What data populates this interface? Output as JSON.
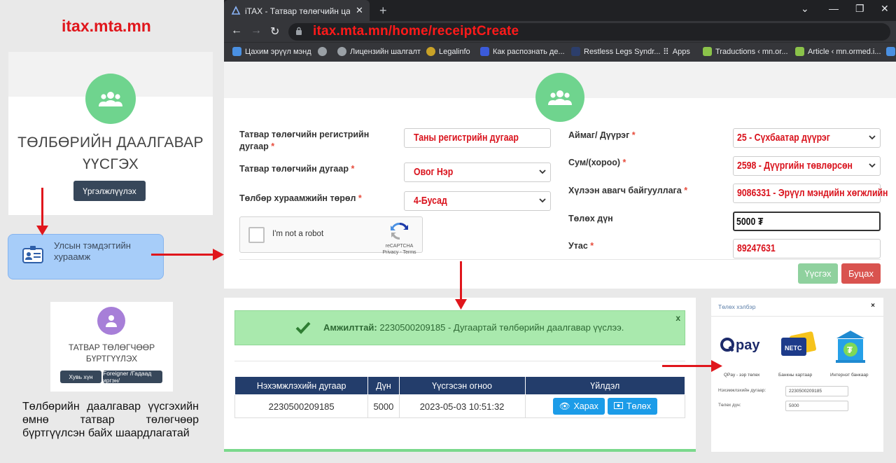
{
  "annotation": {
    "site_title": "itax.mta.mn",
    "note": "Төлбөрийн даалгавар үүсгэхийн өмнө татвар төлөгчөөр бүртгүүлсэн байх шаардлагатай"
  },
  "left_card": {
    "title": "ТӨЛБӨРИЙН ДААЛГАВАР ҮҮСГЭХ",
    "button": "Үргэлжлүүлэх",
    "icon": "users-icon"
  },
  "service_box": {
    "label": "Улсын тэмдэгтийн хураамж",
    "icon": "id-card-icon"
  },
  "register_card": {
    "title": "ТАТВАР ТӨЛӨГЧӨӨР БҮРТГҮҮЛЭХ",
    "btn_citizen": "Хувь хүн",
    "btn_foreigner": "Foreigner /Гадаад иргэн/",
    "icon": "user-icon"
  },
  "browser": {
    "tab_title": "iTAX - Татвар төлөгчийн цахим",
    "url": "itax.mta.mn/home/receiptCreate",
    "bookmarks": [
      {
        "label": "Цахим эрүүл мэнд",
        "color": "#4a90e2"
      },
      {
        "label": "",
        "color": "#9aa0a6"
      },
      {
        "label": "Лицензийн шалгалт",
        "color": "#9aa0a6"
      },
      {
        "label": "Legalinfo",
        "color": "#c9a227"
      },
      {
        "label": "Как распознать де...",
        "color": "#3b5bdb"
      },
      {
        "label": "Restless Legs Syndr...",
        "color": "#2c3e6b"
      },
      {
        "label": "Apps",
        "color": "#9aa0a6"
      },
      {
        "label": "Traductions ‹ mn.or...",
        "color": "#8bc34a"
      },
      {
        "label": "Article ‹ mn.ormed.i...",
        "color": "#8bc34a"
      }
    ]
  },
  "form": {
    "fields": {
      "reg_no": {
        "label": "Татвар төлөгчийн регистрийн дугаар",
        "value": "Таны регистрийн дугаар"
      },
      "tin": {
        "label": "Татвар төлөгчийн дугаар",
        "value": "Овог Нэр"
      },
      "fee_type": {
        "label": "Төлбөр хураамжийн төрөл",
        "value": "4-Бусад"
      },
      "aimag": {
        "label": "Аймаг/ Дүүрэг",
        "value": "25 - Сүхбаатар дүүрэг"
      },
      "sum": {
        "label": "Сум/(хороо)",
        "value": "2598 - Дүүргийн төвлөрсөн"
      },
      "org": {
        "label": "Хүлээн авагч байгууллага",
        "value": "9086331 - Эрүүл мэндийн хөгжлийн"
      },
      "amount": {
        "label": "Төлөх дүн",
        "value": "5000 ₮"
      },
      "phone": {
        "label": "Утас",
        "value": "89247631"
      }
    },
    "required_mark": "*",
    "captcha": {
      "text": "I'm not a robot",
      "brand": "reCAPTCHA",
      "links": "Privacy - Terms"
    },
    "btn_create": "Үүсгэх",
    "btn_back": "Буцах",
    "colors": {
      "create": "#8fd19e",
      "back": "#d9534f"
    }
  },
  "success": {
    "strong": "Амжилттай:",
    "message": " 2230500209185 - Дугаартай төлбөрийн даалгавар үүслээ.",
    "close": "x",
    "table": {
      "headers": [
        "Нэхэмжлэхийн дугаар",
        "Дүн",
        "Үүсгэсэн огноо",
        "Үйлдэл"
      ],
      "row": [
        "2230500209185",
        "5000",
        "2023-05-03 10:51:32"
      ],
      "btn_view": "Харах",
      "btn_pay": "Төлөх"
    }
  },
  "payment": {
    "title": "Төлөх хэлбэр",
    "close": "×",
    "methods": [
      "QPay - ээр төлөх",
      "Банкны картаар",
      "Интернэт банкаар"
    ],
    "qpay_logo": "pay",
    "card_logo": "NETC",
    "invoice_label": "Нэхэмжлэхийн дугаар:",
    "invoice_value": "2230500209185",
    "amount_label": "Төлөх дүн:",
    "amount_value": "5000"
  }
}
